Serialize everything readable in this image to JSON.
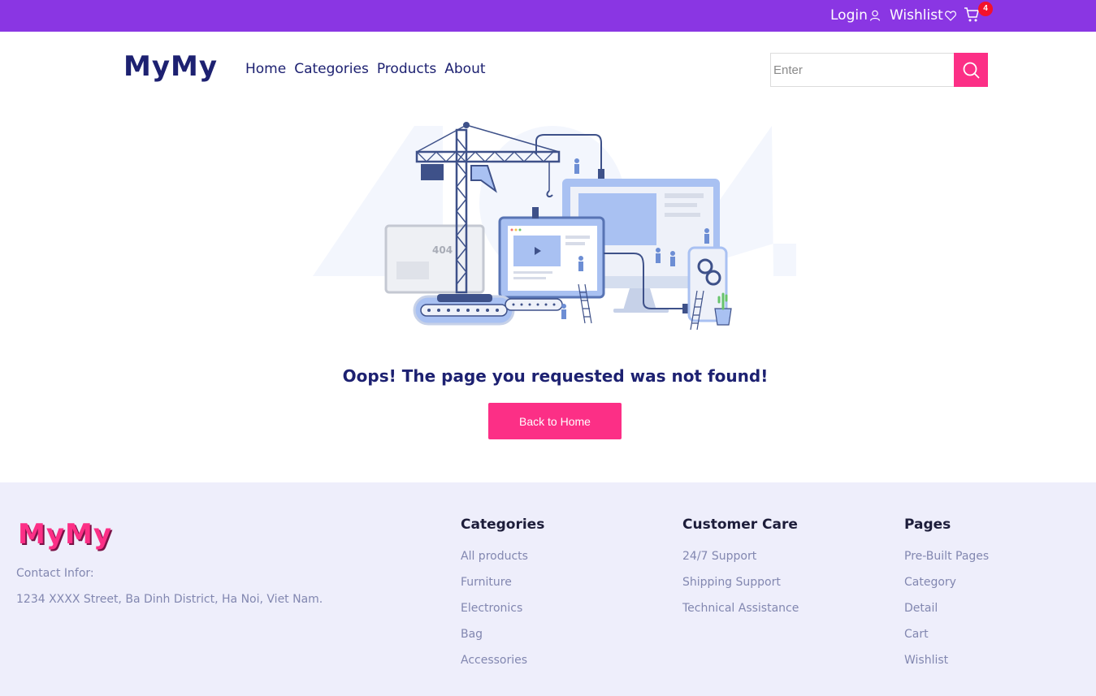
{
  "topbar": {
    "login": "Login",
    "wishlist": "Wishlist",
    "cart_count": "4",
    "icons": [
      "user-icon",
      "heart-icon",
      "cart-icon"
    ]
  },
  "header": {
    "logo": "MyMy",
    "nav": [
      "Home",
      "Categories",
      "Products",
      "About"
    ],
    "search_placeholder": "Enter",
    "search_icon": "search-icon"
  },
  "main": {
    "message": "Oops! The page you requested was not found!",
    "button": "Back to Home",
    "illustration_text": "404"
  },
  "footer": {
    "logo": "MyMy",
    "contact_label": "Contact Infor:",
    "address": "1234 XXXX Street, Ba Dinh District, Ha Noi, Viet Nam.",
    "columns": [
      {
        "title": "Categories",
        "links": [
          "All products",
          "Furniture",
          "Electronics",
          "Bag",
          "Accessories"
        ]
      },
      {
        "title": "Customer Care",
        "links": [
          "24/7 Support",
          "Shipping Support",
          "Technical Assistance"
        ]
      },
      {
        "title": "Pages",
        "links": [
          "Pre-Built Pages",
          "Category",
          "Detail",
          "Cart",
          "Wishlist"
        ]
      }
    ]
  },
  "colors": {
    "topbar": "#8a36e3",
    "navy": "#1d2171",
    "accent_pink": "#fc2f86",
    "footer_bg": "#eeeefb",
    "badge": "#f4112b"
  }
}
